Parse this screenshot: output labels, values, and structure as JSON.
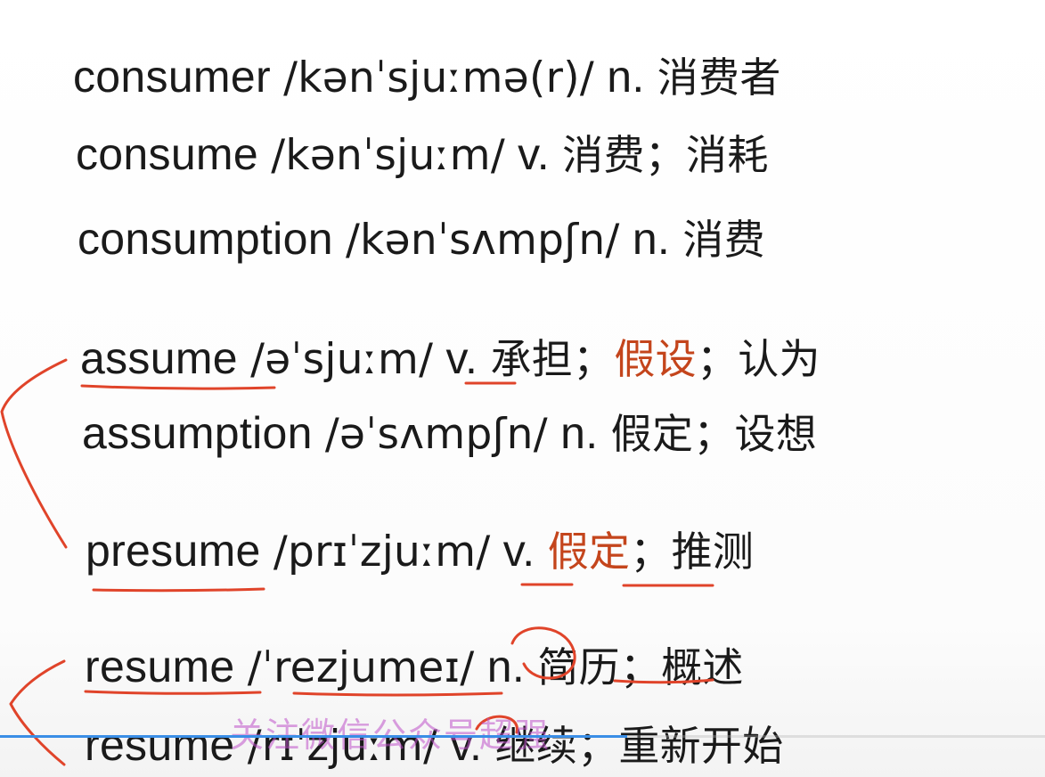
{
  "lines": [
    {
      "word": "consumer",
      "ipa": "/kənˈsjuːmə(r)/",
      "pos": "n.",
      "meaning": "消费者"
    },
    {
      "word": "consume",
      "ipa": "/kənˈsjuːm/",
      "pos": "v.",
      "meaning": "消费；消耗"
    },
    {
      "word": "consumption",
      "ipa": "/kənˈsʌmpʃn/",
      "pos": "n.",
      "meaning": "消费"
    },
    {
      "word": "assume",
      "ipa": "/əˈsjuːm/",
      "pos": "v.",
      "meaning_a": "承担；",
      "meaning_hl": "假设",
      "meaning_b": "；认为"
    },
    {
      "word": "assumption",
      "ipa": "/əˈsʌmpʃn/",
      "pos": "n.",
      "meaning": "假定；设想"
    },
    {
      "word": "presume",
      "ipa": "/prɪˈzjuːm/",
      "pos": "v.",
      "meaning_hl": "假定",
      "meaning_b": "；推测"
    },
    {
      "word": "resume",
      "ipa": "/ˈrezjumeɪ/",
      "pos": "n.",
      "meaning": "简历；概述"
    },
    {
      "word": "resume",
      "ipa": "/rɪˈzjuːm/",
      "pos": "v.",
      "meaning": "继续；重新开始"
    }
  ],
  "overlay": {
    "text": "关注微信公众号超强"
  },
  "colors": {
    "text": "#1a1a1a",
    "highlight": "#c4451c",
    "ink": "#e0442a",
    "overlay": "#be50c8",
    "progress": "#3a8ee6"
  },
  "progress": {
    "fraction": 0.6
  }
}
